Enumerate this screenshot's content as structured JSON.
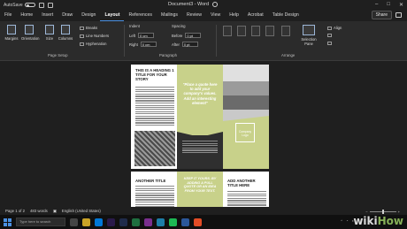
{
  "titlebar": {
    "autosave_label": "AutoSave",
    "document_title": "Document3 - Word"
  },
  "tabs": [
    "File",
    "Home",
    "Insert",
    "Draw",
    "Design",
    "Layout",
    "References",
    "Mailings",
    "Review",
    "View",
    "Help",
    "Acrobat",
    "Table Design"
  ],
  "active_tab": "Layout",
  "share_label": "Share",
  "ribbon": {
    "page_setup": {
      "margins": "Margins",
      "orientation": "Orientation",
      "size": "Size",
      "columns": "Columns",
      "breaks": "Breaks",
      "line_numbers": "Line Numbers",
      "hyphenation": "Hyphenation",
      "group_label": "Page Setup"
    },
    "paragraph": {
      "indent_head": "Indent",
      "spacing_head": "Spacing",
      "left_label": "Left",
      "right_label": "Right",
      "before_label": "Before",
      "after_label": "After",
      "left_value": "0 cm",
      "right_value": "0 cm",
      "before_value": "0 pt",
      "after_value": "0 pt",
      "group_label": "Paragraph"
    },
    "arrange": {
      "selection_pane": "Selection Pane",
      "align": "Align",
      "group_label": "Arrange"
    }
  },
  "document": {
    "page1": {
      "title": "THIS IS A HEADING 1 TITLE FOR YOUR STORY",
      "quote": "\"Place a quote here to add your company's values. Add an interesting element\"",
      "logo_text": "Company Logo"
    },
    "page2": {
      "left_title": "ANOTHER TITLE",
      "quote": "KEEP IT YOURS. BY ADDING A PULL QUOTE OR AN IDEA FROM YOUR TEXT.",
      "right_title": "ADD ANOTHER TITLE HERE"
    }
  },
  "statusbar": {
    "page": "Page 1 of 2",
    "words": "483 words",
    "language": "English (United States)"
  },
  "taskbar": {
    "search_placeholder": "Type here to search"
  },
  "watermark": "wikiHow",
  "colors": {
    "accent_green": "#c8d18a",
    "active_tab_underline": "#4a90e2"
  }
}
